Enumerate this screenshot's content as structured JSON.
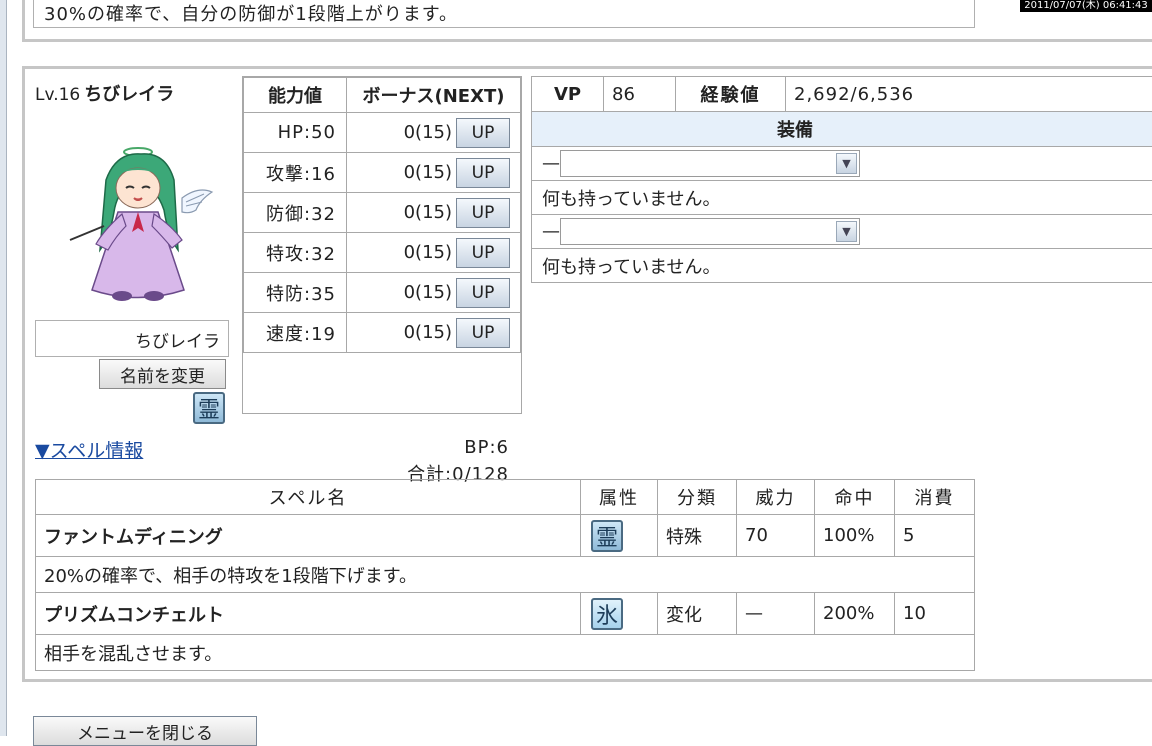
{
  "timestamp": "2011/07/07(木) 06:41:43",
  "top_text": "30%の確率で、自分の防御が1段階上がります。",
  "character": {
    "level": "Lv.16",
    "name": "ちびレイラ",
    "name_box": "ちびレイラ",
    "rename_label": "名前を変更",
    "element_glyph": "霊",
    "element_icon": "spirit-element-icon"
  },
  "stats": {
    "headers": [
      "能力値",
      "ボーナス(NEXT)"
    ],
    "up_label": "UP",
    "rows": [
      {
        "stat": "HP:50",
        "bonus": "0(15)"
      },
      {
        "stat": "攻撃:16",
        "bonus": "0(15)"
      },
      {
        "stat": "防御:32",
        "bonus": "0(15)"
      },
      {
        "stat": "特攻:32",
        "bonus": "0(15)"
      },
      {
        "stat": "特防:35",
        "bonus": "0(15)"
      },
      {
        "stat": "速度:19",
        "bonus": "0(15)"
      }
    ],
    "bp": "BP:6",
    "total": "合計:0/128"
  },
  "equip": {
    "vp_label": "VP",
    "vp_value": "86",
    "exp_label": "経験値",
    "exp_value": "2,692/6,536",
    "header": "装備",
    "slots": [
      {
        "dash": "—",
        "selected": "",
        "desc": "何も持っていません。"
      },
      {
        "dash": "—",
        "selected": "",
        "desc": "何も持っていません。"
      }
    ]
  },
  "spell_link": "▼スペル情報",
  "spells": {
    "headers": [
      "スペル名",
      "属性",
      "分類",
      "威力",
      "命中",
      "消費"
    ],
    "rows": [
      {
        "name": "ファントムディニング",
        "element": "霊",
        "element_icon": "spirit-element-icon",
        "category": "特殊",
        "power": "70",
        "accuracy": "100%",
        "cost": "5",
        "desc": "20%の確率で、相手の特攻を1段階下げます。"
      },
      {
        "name": "プリズムコンチェルト",
        "element": "氷",
        "element_icon": "ice-element-icon",
        "category": "変化",
        "power": "—",
        "accuracy": "200%",
        "cost": "10",
        "desc": "相手を混乱させます。"
      }
    ]
  },
  "close_menu": "メニューを閉じる"
}
